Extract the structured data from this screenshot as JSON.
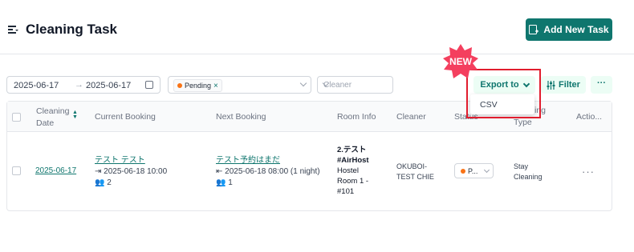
{
  "header": {
    "title": "Cleaning Task",
    "add_button": "Add New Task"
  },
  "filters": {
    "date_from": "2025-06-17",
    "date_arrow": "→",
    "date_to": "2025-06-17",
    "status_tag": "Pending",
    "status_tag_remove": "×",
    "cleaner_placeholder": "Cleaner"
  },
  "toolbar": {
    "export_label": "Export to",
    "filter_label": "Filter",
    "more_label": "···"
  },
  "export_menu": {
    "items": [
      "CSV"
    ]
  },
  "badge": {
    "label": "NEW",
    "color": "#f43f5e"
  },
  "table": {
    "columns": [
      "Cleaning",
      "Date",
      "Current Booking",
      "Next Booking",
      "Room Info",
      "Cleaner",
      "Status",
      "ing",
      "Type",
      "Actio..."
    ],
    "rows": [
      {
        "cleaning_date": "2025-06-17",
        "current_booking": {
          "guest": "テスト テスト",
          "checkout": "2025-06-18 10:00",
          "guests": "2"
        },
        "next_booking": {
          "guest": "テスト予約はまだ",
          "checkin": "2025-06-18 08:00  (1 night)",
          "guests": "1"
        },
        "room_info": [
          "2.テスト",
          "#AirHost",
          "Hostel",
          "Room 1 -",
          "#101"
        ],
        "cleaner": [
          "OKUBOI-",
          "TEST CHIE"
        ],
        "status": "P...",
        "type": [
          "Stay",
          "Cleaning"
        ],
        "actions": "···"
      }
    ]
  },
  "colors": {
    "accent": "#0f766e",
    "pending": "#f97316",
    "highlight": "#e11d2e"
  }
}
